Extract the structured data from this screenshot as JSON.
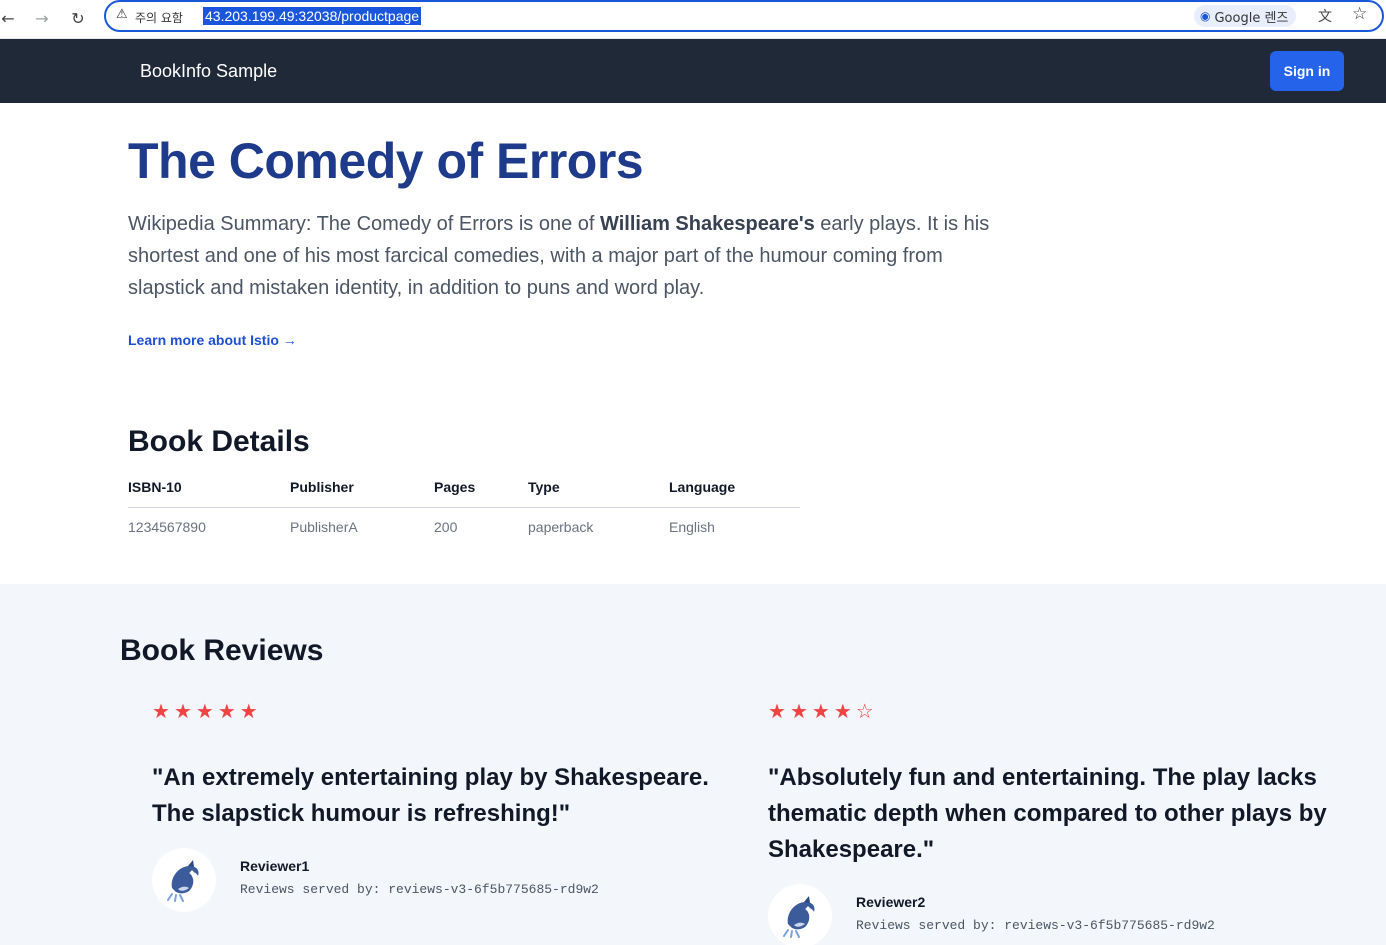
{
  "browser": {
    "back_glyph": "←",
    "forward_glyph": "→",
    "reload_glyph": "↻",
    "warning_glyph": "⚠",
    "warning_label": "주의 요함",
    "url": "43.203.199.49:32038/productpage",
    "lens_label": "Google 렌즈",
    "lens_glyph": "◉",
    "translate_glyph": "文",
    "bookmark_glyph": "☆"
  },
  "header": {
    "brand": "BookInfo Sample",
    "signin_label": "Sign in"
  },
  "product": {
    "title": "The Comedy of Errors",
    "summary_prefix": "Wikipedia Summary: The Comedy of Errors is one of ",
    "summary_bold": "William Shakespeare's",
    "summary_suffix": " early plays. It is his shortest and one of his most farcical comedies, with a major part of the humour coming from slapstick and mistaken identity, in addition to puns and word play.",
    "learn_more": "Learn more about Istio →"
  },
  "details": {
    "title": "Book Details",
    "headers": [
      "ISBN-10",
      "Publisher",
      "Pages",
      "Type",
      "Language"
    ],
    "values": [
      "1234567890",
      "PublisherA",
      "200",
      "paperback",
      "English"
    ]
  },
  "reviews": {
    "title": "Book Reviews",
    "items": [
      {
        "rating": 5,
        "max_rating": 5,
        "star_color": "#ef4444",
        "quote": "\"An extremely entertaining play by Shakespeare. The slapstick humour is refreshing!\"",
        "reviewer": "Reviewer1",
        "served_by": "Reviews served by: reviews-v3-6f5b775685-rd9w2",
        "avatar_icon": "dolphin-icon"
      },
      {
        "rating": 4,
        "max_rating": 5,
        "star_color": "#ef4444",
        "quote": "\"Absolutely fun and entertaining. The play lacks thematic depth when compared to other plays by Shakespeare.\"",
        "reviewer": "Reviewer2",
        "served_by": "Reviews served by: reviews-v3-6f5b775685-rd9w2",
        "avatar_icon": "dolphin-icon"
      }
    ]
  }
}
